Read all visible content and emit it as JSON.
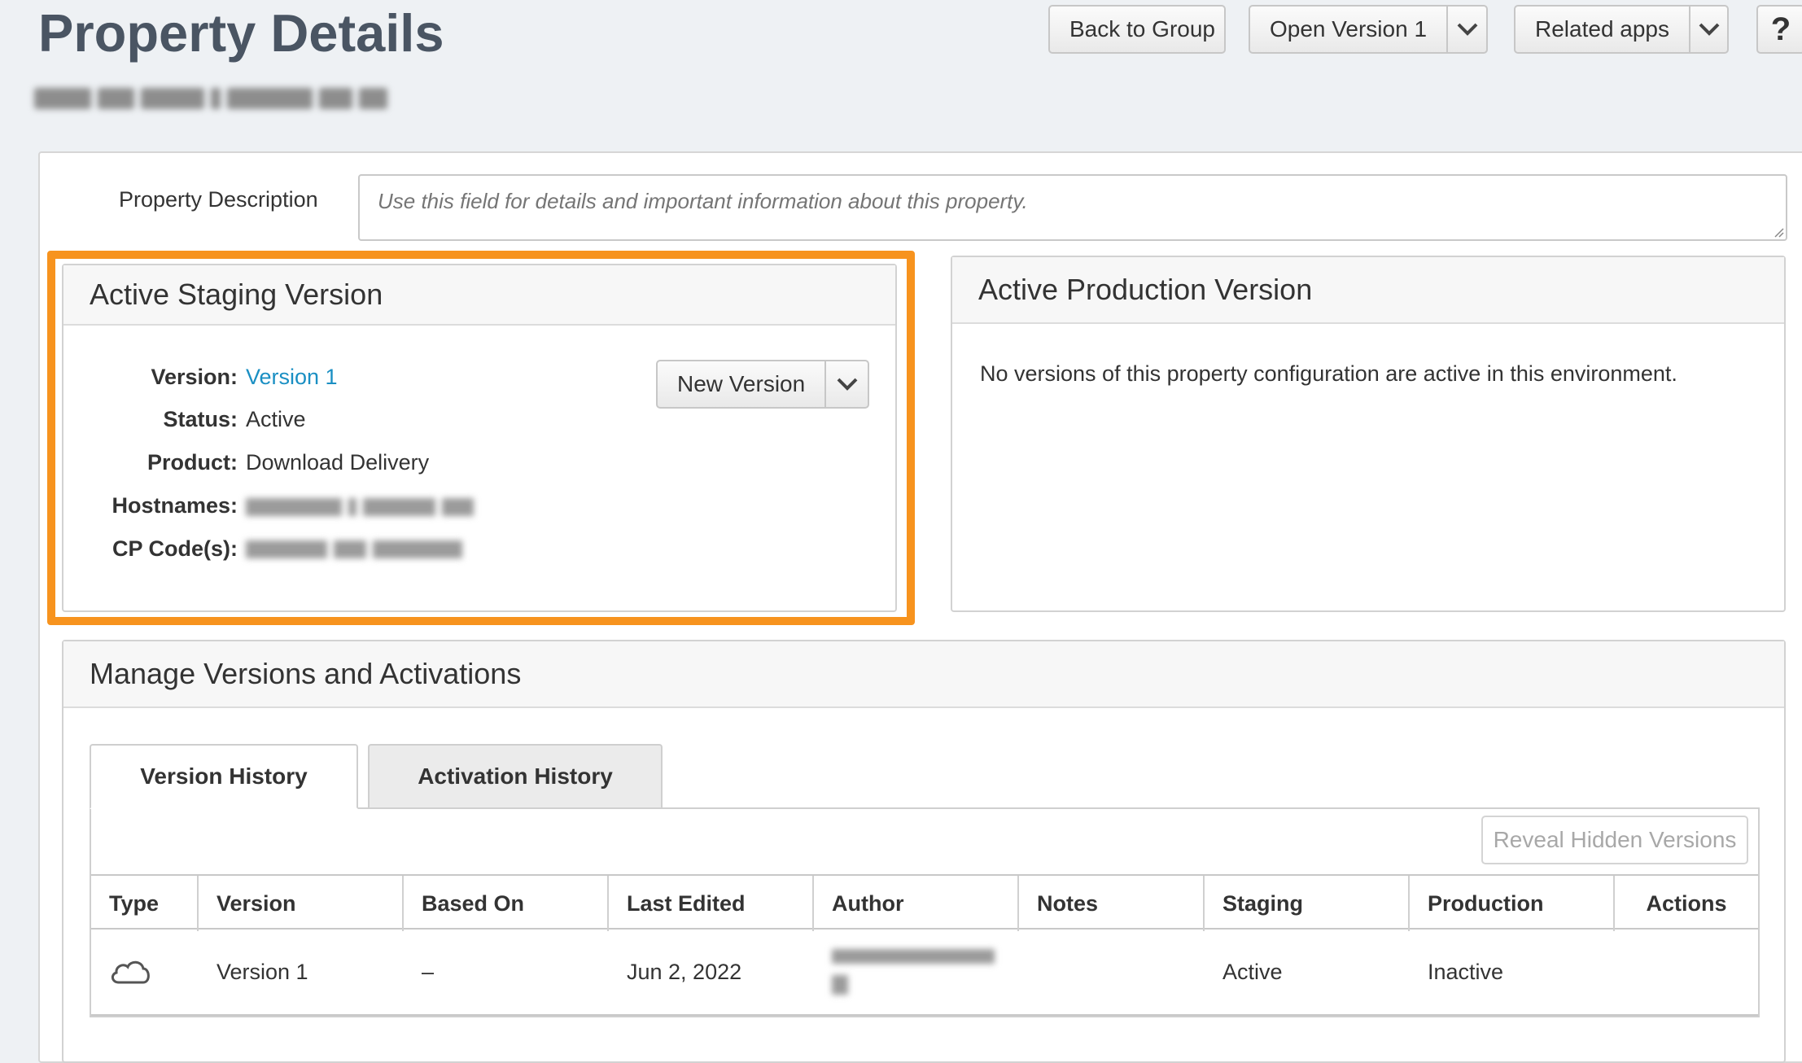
{
  "header": {
    "title": "Property Details",
    "back_label": "Back to Group",
    "open_version_label": "Open Version 1",
    "related_apps_label": "Related apps",
    "help_label": "?"
  },
  "description": {
    "label": "Property Description",
    "placeholder": "Use this field for details and important information about this property."
  },
  "staging": {
    "title": "Active Staging Version",
    "new_version_label": "New Version",
    "fields": {
      "version_label": "Version:",
      "version_value": "Version 1",
      "status_label": "Status:",
      "status_value": "Active",
      "product_label": "Product:",
      "product_value": "Download Delivery",
      "hostnames_label": "Hostnames:",
      "cpcodes_label": "CP Code(s):"
    }
  },
  "production": {
    "title": "Active Production Version",
    "message": "No versions of this property configuration are active in this environment."
  },
  "manage": {
    "title": "Manage Versions and Activations",
    "tabs": [
      "Version History",
      "Activation History"
    ],
    "reveal_label": "Reveal Hidden Versions",
    "columns": [
      "Type",
      "Version",
      "Based On",
      "Last Edited",
      "Author",
      "Notes",
      "Staging",
      "Production",
      "Actions"
    ],
    "rows": [
      {
        "type_icon": "cloud-icon",
        "version": "Version 1",
        "based_on": "–",
        "last_edited": "Jun 2, 2022",
        "notes": "",
        "staging": "Active",
        "production": "Inactive",
        "actions": ""
      }
    ]
  },
  "colors": {
    "highlight": "#f7931e",
    "link": "#1a8fc3"
  }
}
